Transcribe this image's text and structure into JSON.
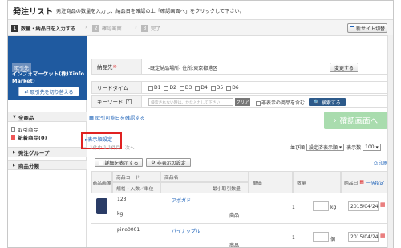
{
  "header": {
    "title": "発注リスト",
    "description": "発注商品の数量を入力し、納品日を確認の上「確認画面へ」をクリックして下さい。",
    "new_site_label": "新サイト切替"
  },
  "steps": [
    {
      "num": "1",
      "label": "数量・納品日を入力する",
      "state": "active"
    },
    {
      "num": "2",
      "label": "確認画面",
      "state": "inactive"
    },
    {
      "num": "3",
      "label": "完了",
      "state": "inactive"
    }
  ],
  "sidebar": {
    "customer_label": "取引先",
    "customer_name": "インフォマーケット(株)Xinfo Market)",
    "switch_label": "取引先を切り替える",
    "all_products": "全商品",
    "items": [
      {
        "label": "取引商品",
        "count": ""
      },
      {
        "label": "新着商品(0)",
        "count": ""
      }
    ],
    "order_group": "発注グループ",
    "product_category": "商品分類"
  },
  "form": {
    "dest_label": "納品先",
    "dest_value": "-既定納品場所- 住所:東京都港区",
    "change_label": "変更する",
    "leadtime_label": "リードタイム",
    "leadtime_options": [
      "D1",
      "D2",
      "D3",
      "D4",
      "D5",
      "D6"
    ],
    "keyword_label": "キーワード",
    "keyword_placeholder": "検索されない時は、かな入力して下さい",
    "clear_label": "クリア",
    "hidden_items_label": "非表示の商品を含む",
    "search_label": "検索する"
  },
  "confirm_label": "確認画面へ",
  "links": {
    "check_date": "取引可能日を確認する",
    "display_settings": "表示順設定",
    "pagination": "1件中 1-1件目",
    "next": "次へ"
  },
  "list_controls": {
    "sort_label": "並び順",
    "sort_value": "設定済表示順",
    "count_label": "表示数",
    "count_value": "100",
    "detail_btn": "詳細を表示する",
    "hidden_btn": "非表示の設定",
    "print": "印刷"
  },
  "table": {
    "headers": {
      "image": "商品画像",
      "code": "商品コード",
      "spec": "規格・入数／単位",
      "name": "商品名",
      "min": "最小取引数量",
      "price": "単価",
      "qty": "数量",
      "date": "納品日",
      "bulk": "一括指定"
    },
    "rows": [
      {
        "code": "123",
        "name": "アボガド",
        "spec": "kg",
        "type": "商品",
        "min": "1",
        "unit": "kg",
        "date": "2015/04/24"
      },
      {
        "code": "pine0001",
        "name": "パイナップル",
        "spec": "",
        "type": "商品",
        "min": "1",
        "unit": "個",
        "date": "2015/04/24"
      }
    ]
  }
}
